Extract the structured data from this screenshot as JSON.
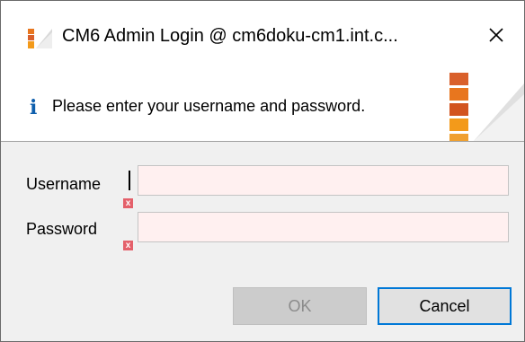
{
  "window": {
    "title": "CM6 Admin Login @ cm6doku-cm1.int.c...",
    "close_symbol": "✕"
  },
  "banner": {
    "info_symbol": "i",
    "message": "Please enter your username and password."
  },
  "form": {
    "username_label": "Username",
    "username_value": "",
    "password_label": "Password",
    "password_value": "",
    "error_symbol": "x"
  },
  "buttons": {
    "ok_label": "OK",
    "cancel_label": "Cancel"
  },
  "colors": {
    "accent": "#0078d7",
    "error": "#e4606a",
    "field_invalid_bg": "#fff0f0",
    "info_blue": "#0f5fad"
  },
  "icons": {
    "app": "cm6-logo-icon",
    "info": "info-icon",
    "close": "close-icon",
    "error": "error-icon"
  }
}
